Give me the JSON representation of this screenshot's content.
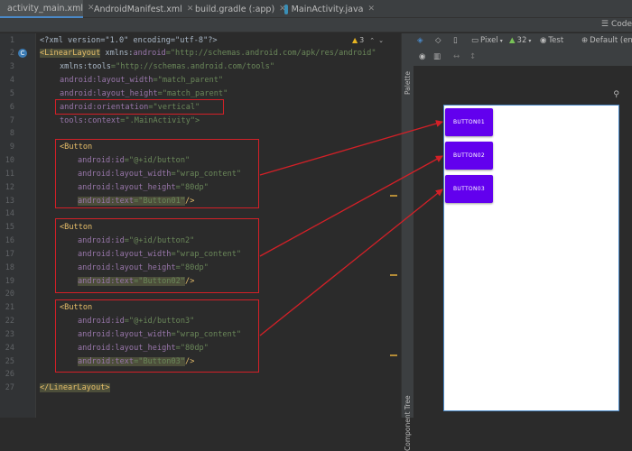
{
  "tabs": [
    {
      "label": "activity_main.xml",
      "active": true,
      "icon_color": "#c06a3a"
    },
    {
      "label": "AndroidManifest.xml",
      "active": false,
      "icon_color": "#c06a3a"
    },
    {
      "label": "build.gradle (:app)",
      "active": false,
      "icon_color": "#5c8ec7"
    },
    {
      "label": "MainActivity.java",
      "active": false,
      "icon_color": "#3a8fb7"
    }
  ],
  "toolbar": {
    "code_label": "Code"
  },
  "gutter": {
    "lines": [
      "1",
      "2",
      "3",
      "4",
      "5",
      "6",
      "7",
      "8",
      "9",
      "10",
      "11",
      "12",
      "13",
      "14",
      "15",
      "16",
      "17",
      "18",
      "19",
      "20",
      "21",
      "22",
      "23",
      "24",
      "25",
      "26",
      "27"
    ]
  },
  "code": {
    "l1": "<?xml version=\"1.0\" encoding=\"utf-8\"?>",
    "l2a": "<LinearLayout",
    "l2b": " xmlns:",
    "l2c": "android",
    "l2d": "=\"http://schemas.android.com/apk/res/android\"",
    "l3a": "xmlns:tools",
    "l3b": "=\"http://schemas.android.com/tools\"",
    "l4a": "android:layout_width",
    "l4b": "=\"match_parent\"",
    "l5a": "android:layout_height",
    "l5b": "=\"match_parent\"",
    "l6a": "android:orientation",
    "l6b": "=\"vertical\"",
    "l7a": "tools:context",
    "l7b": "=\".MainActivity\">",
    "btn_open": "<Button",
    "id_attr": "android:id",
    "id1": "=\"@+id/button\"",
    "id2": "=\"@+id/button2\"",
    "id3": "=\"@+id/button3\"",
    "w_attr": "android:layout_width",
    "w_val": "=\"wrap_content\"",
    "h_attr": "android:layout_height",
    "h_val": "=\"80dp\"",
    "t_attr": "android:text",
    "t1": "=\"Button01\"",
    "t2": "=\"Button02\"",
    "t3": "=\"Button03\"",
    "close": "/>",
    "end": "</LinearLayout>",
    "warning_count": "3"
  },
  "design": {
    "device": "Pixel",
    "api": "32",
    "theme": "Test",
    "locale": "Default (en-",
    "palette_label": "Palette",
    "tree_label": "Component Tree",
    "buttons": [
      "BUTTON01",
      "BUTTON02",
      "BUTTON03"
    ]
  },
  "colors": {
    "accent": "#6200ee",
    "annotation": "#d32027"
  }
}
